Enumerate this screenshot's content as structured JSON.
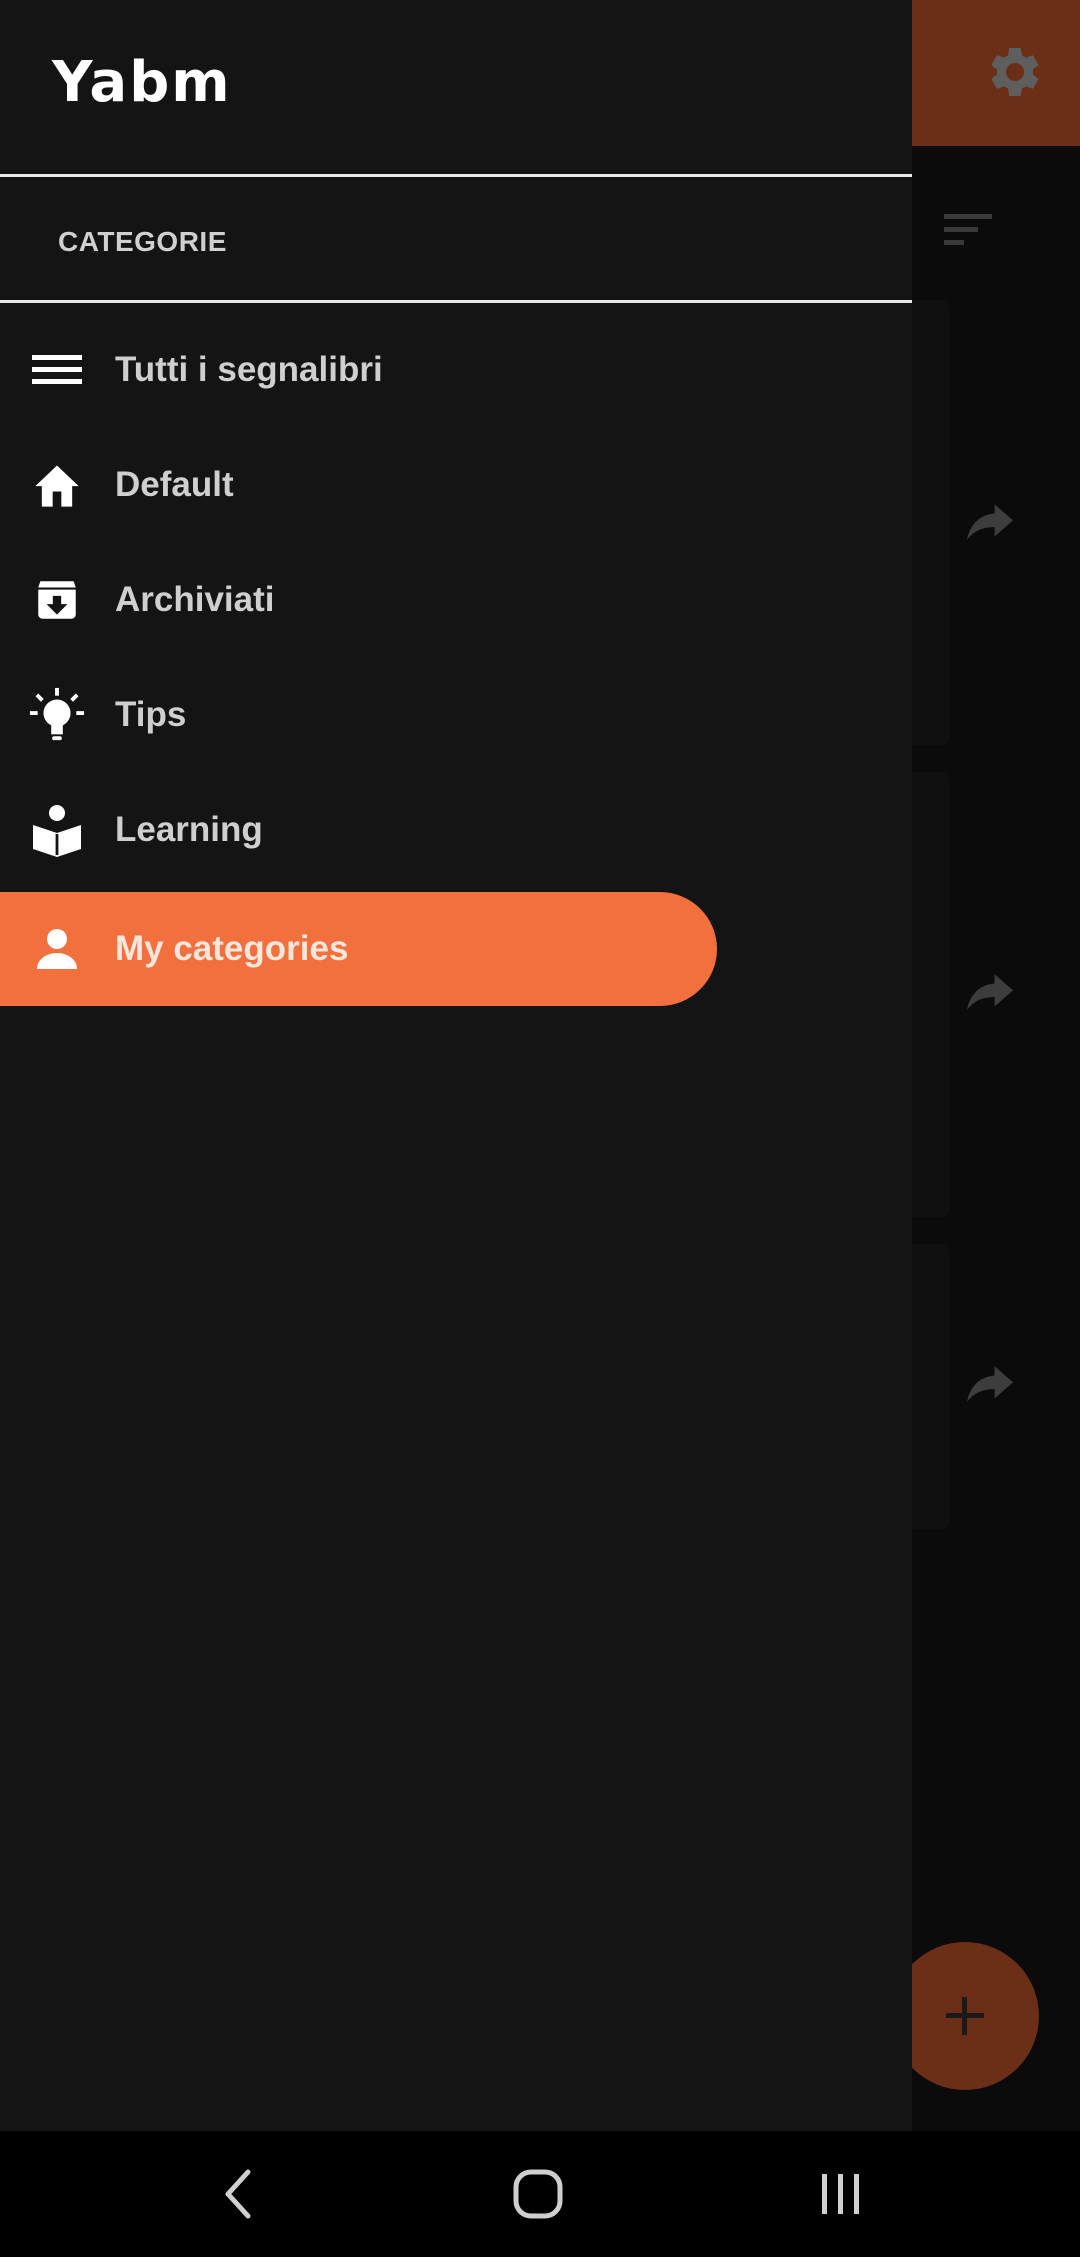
{
  "app": {
    "title": "Yabm"
  },
  "drawer": {
    "section_header": "CATEGORIE",
    "items": [
      {
        "label": "Tutti i segnalibri",
        "icon": "menu-icon",
        "active": false
      },
      {
        "label": "Default",
        "icon": "home-icon",
        "active": false
      },
      {
        "label": "Archiviati",
        "icon": "archive-icon",
        "active": false
      },
      {
        "label": "Tips",
        "icon": "lightbulb-icon",
        "active": false
      },
      {
        "label": "Learning",
        "icon": "book-reader-icon",
        "active": false
      },
      {
        "label": "My categories",
        "icon": "person-icon",
        "active": true
      }
    ]
  },
  "background": {
    "icons": [
      "settings-icon",
      "sort-icon",
      "share-icon",
      "add-icon"
    ]
  },
  "system_nav": {
    "icons": [
      "back-icon",
      "home-circle-icon",
      "recents-icon"
    ]
  },
  "colors": {
    "accent": "#f26f3e",
    "drawer_bg": "#141415",
    "topbar_dimmed": "#6b2e17"
  }
}
